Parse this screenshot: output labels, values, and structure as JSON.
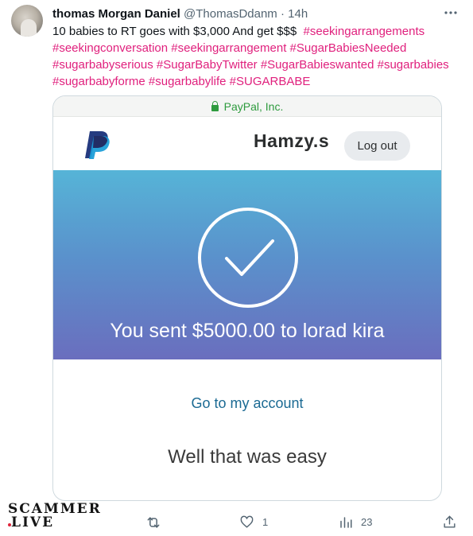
{
  "tweet": {
    "author_name": "thomas Morgan Daniel",
    "author_handle": "@ThomasDdanm",
    "separator": "·",
    "time": "14h",
    "text": "10 babies to RT goes with $3,000 And get $$$",
    "hashtags": [
      "#seekingarrangements",
      "#seekingconversation",
      "#seekingarrangement",
      "#SugarBabiesNeeded",
      "#sugarbabyserious",
      "#SugarBabyTwitter",
      "#SugarBabieswanted",
      "#sugarbabies",
      "#sugarbabyforme",
      "#sugarbabylife",
      "#SUGARBABE"
    ],
    "hashtag_color": "#e0207d"
  },
  "screenshot": {
    "url_label": "PayPal, Inc.",
    "merchant_name": "Hamzy.s",
    "logout_label": "Log out",
    "success_message": "You sent $5000.00 to lorad kira",
    "account_link": "Go to my account",
    "closing_text": "Well that was easy",
    "icons": [
      "lock-icon",
      "paypal-logo",
      "check-circle-icon"
    ],
    "colors": {
      "gradient_top": "#56b4d7",
      "gradient_bottom": "#6a6ebe",
      "link": "#1b6a93",
      "secure": "#2e9b3e"
    }
  },
  "watermark": {
    "line1": "SCAMMER",
    "line2": "LIVE"
  },
  "actions": {
    "reply_count": "",
    "retweet_count": "",
    "like_count": "1",
    "views_count": "23",
    "icons": [
      "reply-icon",
      "retweet-icon",
      "like-icon",
      "views-icon",
      "share-icon"
    ]
  }
}
